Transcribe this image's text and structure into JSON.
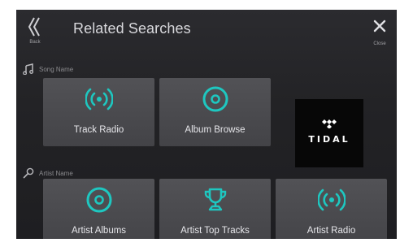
{
  "header": {
    "back_label": "Back",
    "title": "Related Searches",
    "close_label": "Close"
  },
  "sections": [
    {
      "label": "Song Name",
      "icon": "music-note-icon",
      "tiles": [
        {
          "label": "Track Radio",
          "icon": "radio-waves-icon"
        },
        {
          "label": "Album Browse",
          "icon": "disc-icon"
        }
      ],
      "brand_tile": {
        "label": "TIDAL",
        "icon": "tidal-logo-icon"
      }
    },
    {
      "label": "Artist Name",
      "icon": "microphone-icon",
      "tiles": [
        {
          "label": "Artist Albums",
          "icon": "disc-icon"
        },
        {
          "label": "Artist Top Tracks",
          "icon": "trophy-icon"
        },
        {
          "label": "Artist Radio",
          "icon": "radio-waves-icon"
        }
      ]
    }
  ],
  "colors": {
    "accent": "#1ec7c0",
    "tile": "#4c4c50",
    "background": "#242427",
    "text": "#e6e6ea"
  }
}
